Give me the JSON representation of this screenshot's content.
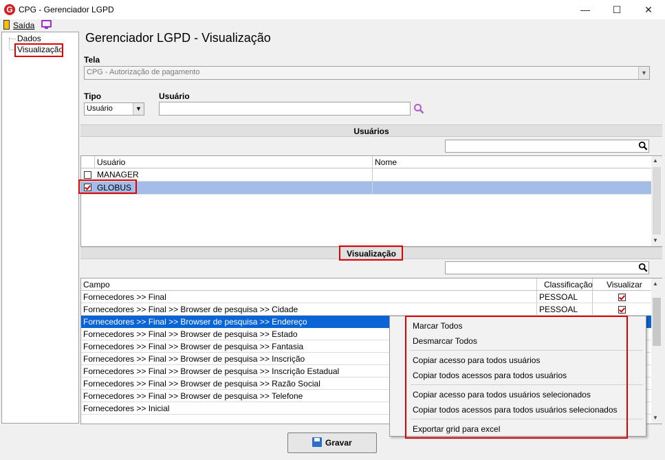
{
  "window": {
    "title": "CPG - Gerenciador LGPD",
    "minimize": "—",
    "maximize": "☐",
    "close": "✕",
    "logo": "G"
  },
  "menu": {
    "exit_label": "Saída"
  },
  "tree": {
    "items": [
      "Dados",
      "Visualização"
    ]
  },
  "page": {
    "title": "Gerenciador LGPD - Visualização"
  },
  "tela": {
    "label": "Tela",
    "value": "CPG - Autorização de pagamento"
  },
  "tipo": {
    "label": "Tipo",
    "value": "Usuário"
  },
  "usuario": {
    "label": "Usuário",
    "value": ""
  },
  "usuarios_section": {
    "title": "Usuários",
    "columns": [
      "Usuário",
      "Nome"
    ],
    "rows": [
      {
        "usuario": "MANAGER",
        "nome": "",
        "checked": false
      },
      {
        "usuario": "GLOBUS",
        "nome": "",
        "checked": true
      }
    ]
  },
  "visualizacao_section": {
    "title": "Visualização",
    "columns": [
      "Campo",
      "Classificação",
      "Visualizar"
    ],
    "rows": [
      {
        "campo": "Fornecedores >> Final",
        "classificacao": "PESSOAL",
        "visualizar": true
      },
      {
        "campo": "Fornecedores >> Final >> Browser de pesquisa >> Cidade",
        "classificacao": "PESSOAL",
        "visualizar": true
      },
      {
        "campo": "Fornecedores >> Final >> Browser de pesquisa >> Endereço",
        "classificacao": "",
        "visualizar": false
      },
      {
        "campo": "Fornecedores >> Final >> Browser de pesquisa >> Estado",
        "classificacao": "",
        "visualizar": false
      },
      {
        "campo": "Fornecedores >> Final >> Browser de pesquisa >> Fantasia",
        "classificacao": "",
        "visualizar": false
      },
      {
        "campo": "Fornecedores >> Final >> Browser de pesquisa >> Inscrição",
        "classificacao": "",
        "visualizar": false
      },
      {
        "campo": "Fornecedores >> Final >> Browser de pesquisa >> Inscrição Estadual",
        "classificacao": "",
        "visualizar": false
      },
      {
        "campo": "Fornecedores >> Final >> Browser de pesquisa >> Razão Social",
        "classificacao": "",
        "visualizar": false
      },
      {
        "campo": "Fornecedores >> Final >> Browser de pesquisa >> Telefone",
        "classificacao": "",
        "visualizar": false
      },
      {
        "campo": "Fornecedores >> Inicial",
        "classificacao": "",
        "visualizar": false
      }
    ]
  },
  "context_menu": {
    "items": [
      "Marcar Todos",
      "Desmarcar Todos",
      "Copiar acesso para todos usuários",
      "Copiar todos acessos para todos usuários",
      "Copiar acesso para todos usuários selecionados",
      "Copiar todos acessos para todos usuários selecionados",
      "Exportar grid para excel"
    ]
  },
  "footer": {
    "save_label": "Gravar"
  },
  "colors": {
    "selection": "#0a64d6",
    "highlight_row": "#a3bde8",
    "annotation": "#e00000"
  }
}
